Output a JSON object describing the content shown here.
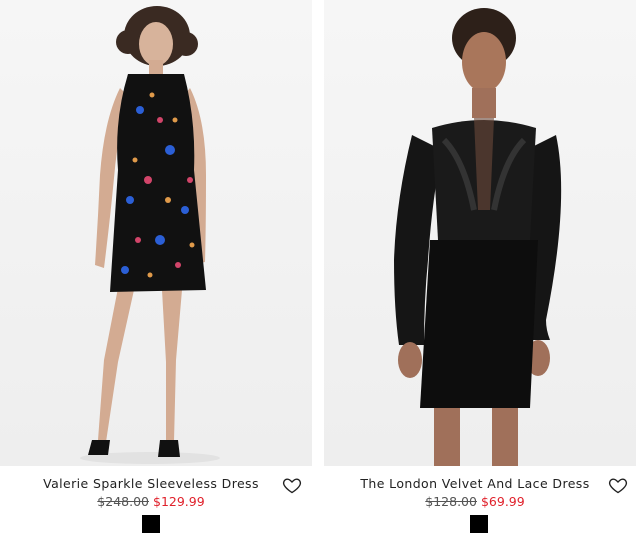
{
  "products": [
    {
      "name": "Valerie Sparkle Sleeveless Dress",
      "was_price": "$248.00",
      "now_price": "$129.99",
      "swatch_color": "#000000",
      "favorite_icon": "heart-outline-icon"
    },
    {
      "name": "The London Velvet And Lace Dress",
      "was_price": "$128.00",
      "now_price": "$69.99",
      "swatch_color": "#000000",
      "favorite_icon": "heart-outline-icon"
    }
  ],
  "colors": {
    "sale_price": "#e0212b",
    "text": "#222222"
  }
}
